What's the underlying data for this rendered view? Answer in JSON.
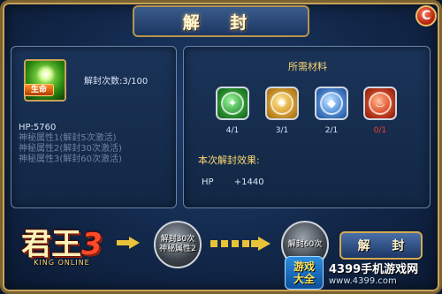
{
  "header": {
    "title": "解 封",
    "close_glyph": "C"
  },
  "item": {
    "icon": "life-orb-icon",
    "badge": "生命",
    "unlock_count_label": "解封次数:3/100"
  },
  "stats": {
    "hp": "HP:5760",
    "hidden_1": "神秘属性1(解封5次激活)",
    "hidden_2": "神秘属性2(解封30次激活)",
    "hidden_3": "神秘属性3(解封60次激活)"
  },
  "materials": {
    "title": "所需材料",
    "items": [
      {
        "icon": "green-gem-icon",
        "count": "4/1",
        "color": "#2fae34"
      },
      {
        "icon": "gold-gem-icon",
        "count": "3/1",
        "color": "#e0a21a"
      },
      {
        "icon": "blue-gem-icon",
        "count": "2/1",
        "color": "#3c86e0"
      },
      {
        "icon": "red-gem-icon",
        "count": "0/1",
        "color": "#ff3b2a"
      }
    ]
  },
  "effect": {
    "title": "本次解封效果:",
    "stat": "HP",
    "value": "+1440"
  },
  "progress": {
    "logo_main": "君王",
    "logo_three": "3",
    "logo_sub": "KING ONLINE",
    "milestone_1": "解封30次\n神秘属性2",
    "milestone_2": "解封60次"
  },
  "actions": {
    "unlock_label": "解 封"
  },
  "watermark": {
    "badge_top": "游戏",
    "badge_bottom": "大全",
    "site_name": "4399手机游戏网",
    "url": "www.4399.com"
  }
}
